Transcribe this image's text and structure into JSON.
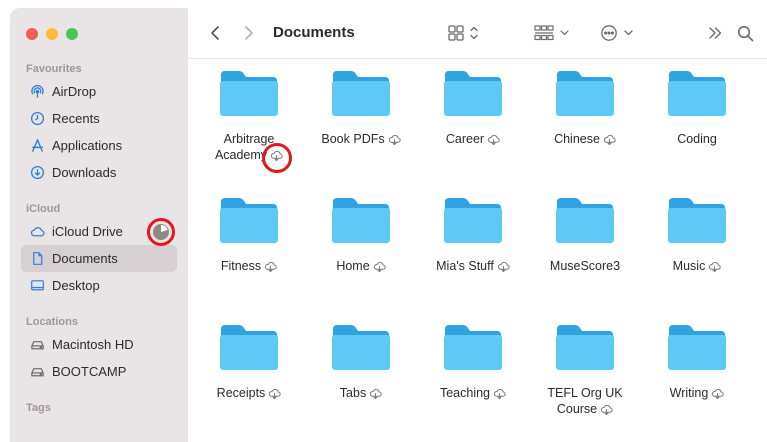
{
  "window": {
    "title": "Documents"
  },
  "sidebar": {
    "sections": [
      {
        "title": "Favourites",
        "items": [
          {
            "label": "AirDrop",
            "icon": "airdrop-icon"
          },
          {
            "label": "Recents",
            "icon": "clock-icon"
          },
          {
            "label": "Applications",
            "icon": "applications-icon"
          },
          {
            "label": "Downloads",
            "icon": "download-icon"
          }
        ]
      },
      {
        "title": "iCloud",
        "items": [
          {
            "label": "iCloud Drive",
            "icon": "cloud-icon"
          },
          {
            "label": "Documents",
            "icon": "document-icon",
            "selected": true
          },
          {
            "label": "Desktop",
            "icon": "desktop-icon"
          }
        ]
      },
      {
        "title": "Locations",
        "items": [
          {
            "label": "Macintosh HD",
            "icon": "drive-icon"
          },
          {
            "label": "BOOTCAMP",
            "icon": "drive-icon"
          }
        ]
      },
      {
        "title": "Tags",
        "items": []
      }
    ]
  },
  "folders": [
    {
      "name_line1": "Arbitrage",
      "name_line2": "Academy",
      "cloud": true
    },
    {
      "name_line1": "Book PDFs",
      "name_line2": "",
      "cloud": true
    },
    {
      "name_line1": "Career",
      "name_line2": "",
      "cloud": true
    },
    {
      "name_line1": "Chinese",
      "name_line2": "",
      "cloud": true
    },
    {
      "name_line1": "Coding",
      "name_line2": "",
      "cloud": false
    },
    {
      "name_line1": "Fitness",
      "name_line2": "",
      "cloud": true
    },
    {
      "name_line1": "Home",
      "name_line2": "",
      "cloud": true
    },
    {
      "name_line1": "Mia's Stuff",
      "name_line2": "",
      "cloud": true
    },
    {
      "name_line1": "MuseScore3",
      "name_line2": "",
      "cloud": false
    },
    {
      "name_line1": "Music",
      "name_line2": "",
      "cloud": true
    },
    {
      "name_line1": "Receipts",
      "name_line2": "",
      "cloud": true
    },
    {
      "name_line1": "Tabs",
      "name_line2": "",
      "cloud": true
    },
    {
      "name_line1": "Teaching",
      "name_line2": "",
      "cloud": true
    },
    {
      "name_line1": "TEFL Org UK",
      "name_line2": "Course",
      "cloud": true
    },
    {
      "name_line1": "Writing",
      "name_line2": "",
      "cloud": true
    }
  ],
  "colors": {
    "folder_front": "#5ec8f7",
    "folder_back": "#2ea3df",
    "highlight_ring": "#e3181b",
    "sidebar_bg": "#e9e4e6"
  }
}
